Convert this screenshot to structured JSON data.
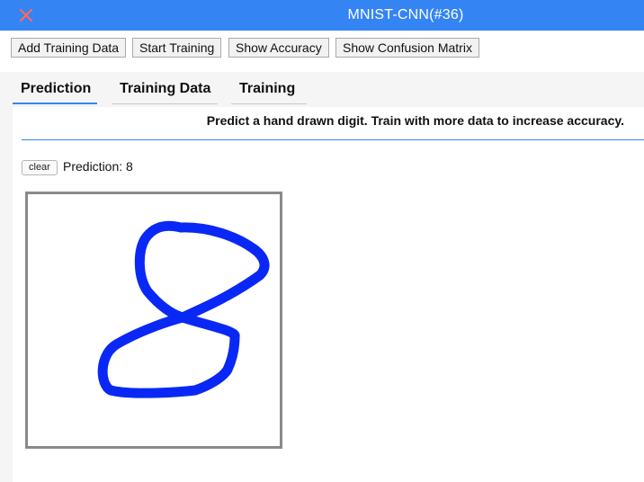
{
  "window": {
    "title": "MNIST-CNN(#36)",
    "close_icon": "close-x-icon",
    "titlebar_color": "#3584f4",
    "close_color": "#ff6a5b"
  },
  "toolbar": {
    "add_training_data": "Add Training Data",
    "start_training": "Start Training",
    "show_accuracy": "Show Accuracy",
    "show_confusion_matrix": "Show Confusion Matrix"
  },
  "tabs": [
    {
      "label": "Prediction",
      "active": true
    },
    {
      "label": "Training Data",
      "active": false
    },
    {
      "label": "Training",
      "active": false
    }
  ],
  "prediction_panel": {
    "instruction": "Predict a hand drawn digit. Train with more data to increase accuracy.",
    "clear_label": "clear",
    "prediction_text": "Prediction: 8",
    "stroke_color": "#0a28f5"
  }
}
